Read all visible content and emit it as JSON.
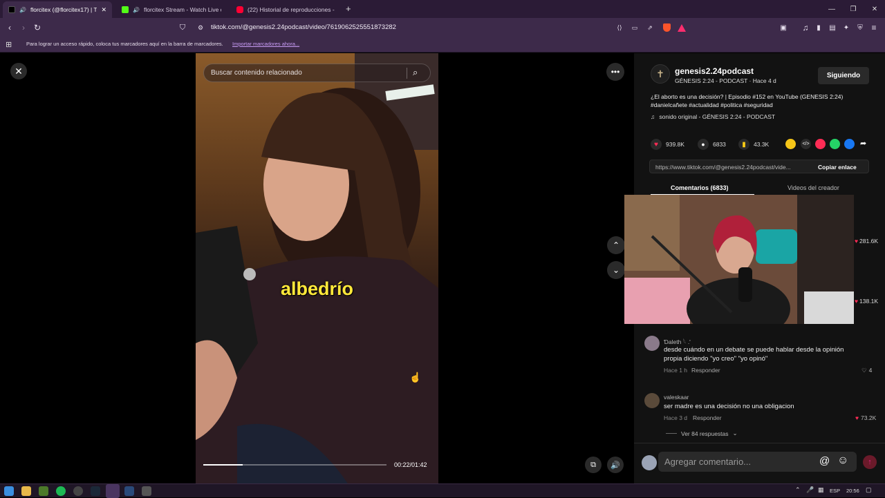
{
  "browser": {
    "tabs": [
      {
        "title": "florcitex (@florcitex17) | TikTo",
        "active": true
      },
      {
        "title": "florcitex Stream - Watch Live on",
        "active": false
      },
      {
        "title": "(22) Historial de reproducciones - Yo",
        "active": false
      }
    ],
    "url": "tiktok.com/@genesis2.24podcast/video/7619062525551873282",
    "bookmarks_hint": "Para lograr un acceso rápido, coloca tus marcadores aquí en la barra de marcadores.",
    "bookmarks_import": "Importar marcadores ahora..."
  },
  "video": {
    "search_placeholder": "Buscar contenido relacionado",
    "caption": "albedrío",
    "time": "00:22/01:42",
    "progress": 0.215
  },
  "creator": {
    "username": "genesis2.24podcast",
    "subtitle": "GÉNESIS 2:24 - PODCAST · Hace 4 d",
    "follow_label": "Siguiendo",
    "description": "¿El aborto es una decisión? | Episodio #152 en YouTube (GENESIS 2:24) #danielcañete #actualidad #politica #seguridad",
    "sound": "sonido original - GÉNESIS 2:24 - PODCAST"
  },
  "stats": {
    "likes": "939.8K",
    "comments": "6833",
    "saves": "43.3K"
  },
  "link": {
    "url": "https://www.tiktok.com/@genesis2.24podcast/vide...",
    "copy_label": "Copiar enlace"
  },
  "panel_tabs": {
    "comments": "Comentarios (6833)",
    "creator_videos": "Videos del creador"
  },
  "side_likes": [
    "281.6K",
    "138.1K"
  ],
  "comments": [
    {
      "user": "Ɗaleth 𓆩 .'",
      "text": "desde cuándo en un debate se puede hablar desde la opinión propia diciendo \"yo creo\" \"yo opinó\"",
      "time": "Hace 1 h",
      "reply": "Responder",
      "likes": "4"
    },
    {
      "user": "valeskaar",
      "text": "ser madre es una decisión no una obligacion",
      "time": "Hace 3 d",
      "reply": "Responder",
      "likes": "73.2K"
    }
  ],
  "view_replies": "Ver 84 respuestas",
  "comment_input_placeholder": "Agregar comentario...",
  "taskbar": {
    "lang": "ESP",
    "time": "20:56"
  },
  "colors": {
    "accent": "#fe2c55",
    "caption": "#ffe83a",
    "tab_bg": "#2b1b36",
    "toolbar_bg": "#3d2a4a"
  }
}
